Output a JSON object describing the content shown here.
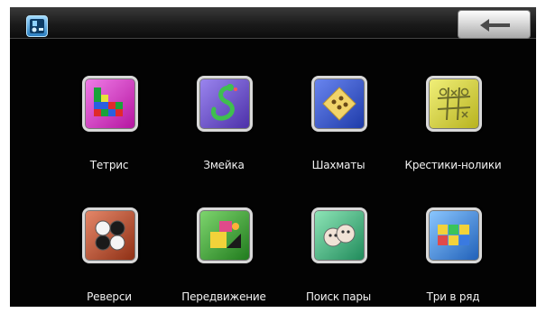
{
  "topbar": {
    "app_icon": "app-settings-icon",
    "back_icon": "left-arrow-icon"
  },
  "games": [
    {
      "label": "Тетрис",
      "icon": "tetris-icon",
      "color": "#d21ec2"
    },
    {
      "label": "Змейка",
      "icon": "snake-icon",
      "color": "#6c4fc4"
    },
    {
      "label": "Шахматы",
      "icon": "chess-board-icon",
      "color": "#2a4fc8"
    },
    {
      "label": "Крестики-нолики",
      "icon": "tic-tac-toe-icon",
      "color": "#c9c92e"
    },
    {
      "label": "Реверси",
      "icon": "reversi-icon",
      "color": "#b24a2a"
    },
    {
      "label": "Передвижение",
      "icon": "move-puzzle-icon",
      "color": "#35a22f"
    },
    {
      "label": "Поиск пары",
      "icon": "find-pair-icon",
      "color": "#3bb07c"
    },
    {
      "label": "Три в ряд",
      "icon": "three-in-row-icon",
      "color": "#3a8fe0"
    }
  ]
}
